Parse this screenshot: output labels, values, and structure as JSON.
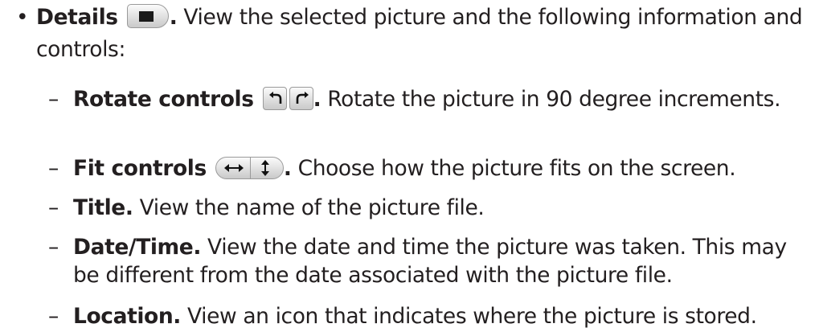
{
  "details": {
    "bullet": "•",
    "title": "Details",
    "period": ".",
    "text": "View the selected picture and the following information and controls:",
    "icon": "details-button-icon"
  },
  "items": [
    {
      "dash": "–",
      "title": "Rotate controls",
      "period": ".",
      "text": "Rotate the picture in 90 degree increments.",
      "icons": [
        "rotate-left-icon",
        "rotate-right-icon"
      ]
    },
    {
      "dash": "–",
      "title": "Fit controls",
      "period": ".",
      "text": "Choose how the picture fits on the screen.",
      "icons": [
        "fit-width-icon",
        "fit-height-icon"
      ]
    },
    {
      "dash": "–",
      "title": "Title.",
      "text": "View the name of the picture file."
    },
    {
      "dash": "–",
      "title": "Date/Time.",
      "text": "View the date and time the picture was taken. This may be different from the date associated with the picture file."
    },
    {
      "dash": "–",
      "title": "Location.",
      "text": "View an icon that indicates where the picture is stored."
    }
  ]
}
